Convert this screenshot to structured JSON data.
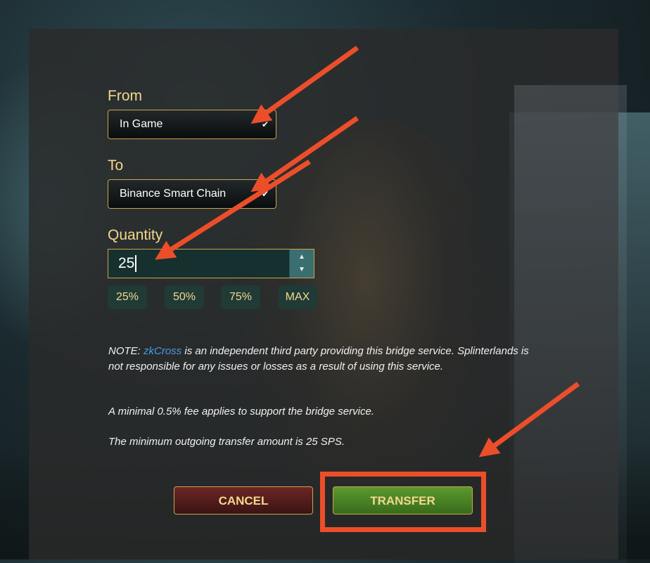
{
  "form": {
    "from_label": "From",
    "from_value": "In Game",
    "to_label": "To",
    "to_value": "Binance Smart Chain",
    "quantity_label": "Quantity",
    "quantity_value": "25",
    "percent_buttons": [
      "25%",
      "50%",
      "75%",
      "MAX"
    ]
  },
  "notes": {
    "note_prefix": "NOTE: ",
    "note_link": "zkCross",
    "note_rest": " is an independent third party providing this bridge service. Splinterlands is not responsible for any issues or losses as a result of using this service.",
    "fee": "A minimal 0.5% fee applies to support the bridge service.",
    "minimum": "The minimum outgoing transfer amount is 25 SPS."
  },
  "actions": {
    "cancel_label": "CANCEL",
    "transfer_label": "TRANSFER"
  },
  "colors": {
    "accent_gold": "#f3d88c",
    "annotation_orange": "#ec4e2a",
    "link_blue": "#4a9be0"
  }
}
